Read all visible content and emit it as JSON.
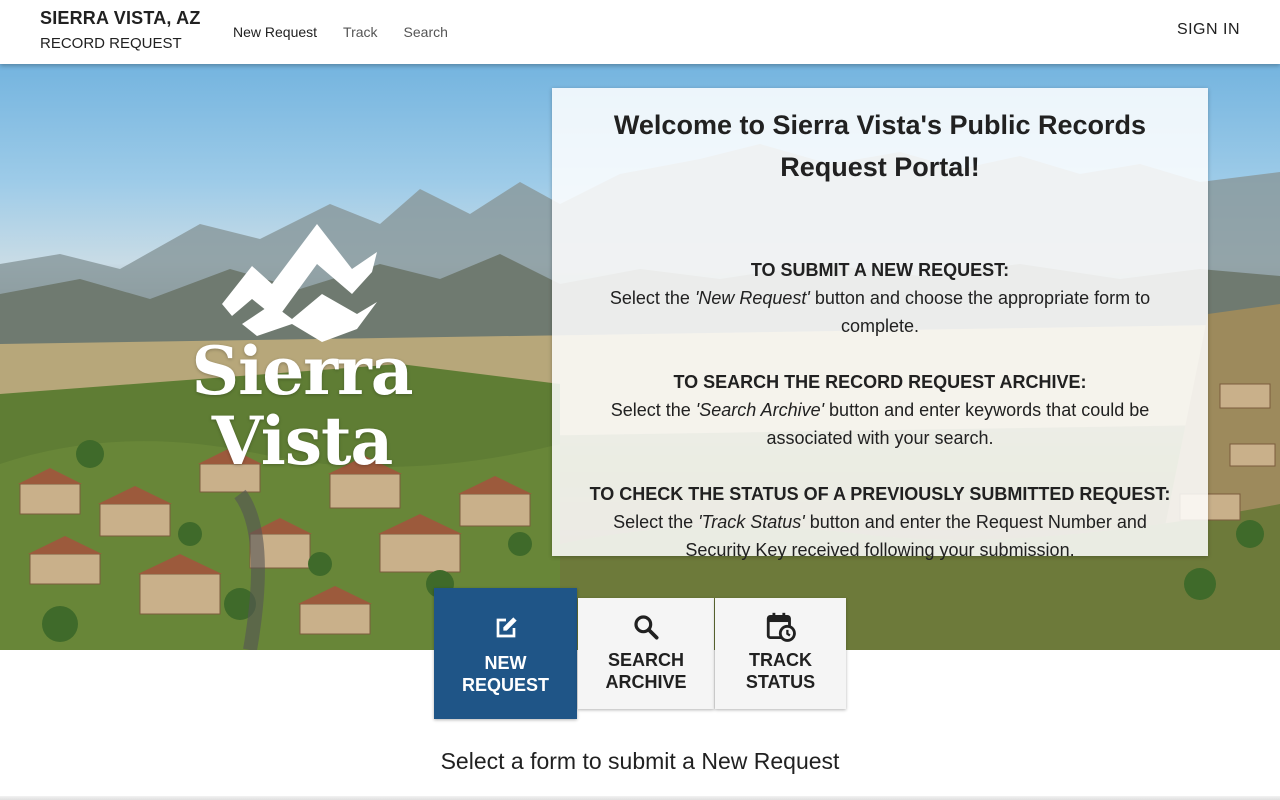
{
  "header": {
    "city": "SIERRA VISTA, AZ",
    "subtitle": "RECORD REQUEST",
    "nav": [
      {
        "label": "New Request"
      },
      {
        "label": "Track"
      },
      {
        "label": "Search"
      }
    ],
    "sign_in": "SIGN IN"
  },
  "hero": {
    "logo_text": "Sierra Vista"
  },
  "welcome": {
    "title": "Welcome to Sierra Vista's Public Records Request Portal!",
    "sections": [
      {
        "heading": "TO SUBMIT A NEW REQUEST:",
        "pre": "Select the ",
        "button_name": "'New Request'",
        "post": " button and choose the appropriate form to complete."
      },
      {
        "heading": "TO SEARCH THE RECORD REQUEST ARCHIVE:",
        "pre": "Select the ",
        "button_name": "'Search Archive'",
        "post": " button and enter keywords that could be associated with your search."
      },
      {
        "heading": "TO CHECK THE STATUS OF A PREVIOUSLY SUBMITTED REQUEST:",
        "pre": "Select the ",
        "button_name": "'Track Status'",
        "post": " button and enter the Request Number and Security Key received following your submission."
      }
    ]
  },
  "actions": [
    {
      "line1": "NEW",
      "line2": "REQUEST",
      "icon": "edit-icon"
    },
    {
      "line1": "SEARCH",
      "line2": "ARCHIVE",
      "icon": "search-icon"
    },
    {
      "line1": "TRACK",
      "line2": "STATUS",
      "icon": "calendar-clock-icon"
    }
  ],
  "main": {
    "select_title": "Select a form to submit a New Request"
  },
  "colors": {
    "primary": "#1f5587",
    "header_bg": "#ffffff",
    "button_bg": "#f5f5f5"
  }
}
